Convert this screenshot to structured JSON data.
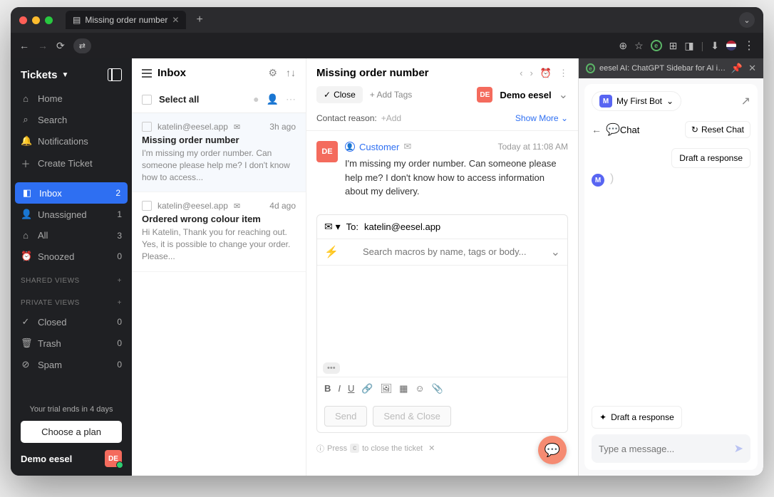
{
  "tab": {
    "title": "Missing order number"
  },
  "ext_bar": {
    "title": "eesel AI: ChatGPT Sidebar for AI in Go..."
  },
  "sidebar": {
    "title": "Tickets",
    "nav": [
      {
        "icon": "⌂",
        "label": "Home"
      },
      {
        "icon": "⌕",
        "label": "Search"
      },
      {
        "icon": "🔔",
        "label": "Notifications"
      },
      {
        "icon": "＋",
        "label": "Create Ticket"
      }
    ],
    "boxes": [
      {
        "icon": "◧",
        "label": "Inbox",
        "count": "2",
        "active": true
      },
      {
        "icon": "👤",
        "label": "Unassigned",
        "count": "1"
      },
      {
        "icon": "⌂",
        "label": "All",
        "count": "3"
      },
      {
        "icon": "⏰",
        "label": "Snoozed",
        "count": "0"
      }
    ],
    "shared": "SHARED VIEWS",
    "private": "PRIVATE VIEWS",
    "views": [
      {
        "icon": "✓",
        "label": "Closed",
        "count": "0"
      },
      {
        "icon": "🗑",
        "label": "Trash",
        "count": "0"
      },
      {
        "icon": "⊘",
        "label": "Spam",
        "count": "0"
      }
    ],
    "trial": "Your trial ends in 4 days",
    "plan": "Choose a plan",
    "account": "Demo eesel",
    "avatar": "DE"
  },
  "inbox": {
    "title": "Inbox",
    "select_all": "Select all",
    "tickets": [
      {
        "from": "katelin@eesel.app",
        "time": "3h ago",
        "subject": "Missing order number",
        "preview": "I'm missing my order number. Can someone please help me? I don't know how to access...",
        "selected": true
      },
      {
        "from": "katelin@eesel.app",
        "time": "4d ago",
        "subject": "Ordered wrong colour item",
        "preview": "Hi Katelin, Thank you for reaching out. Yes, it is possible to change your order. Please..."
      }
    ]
  },
  "thread": {
    "title": "Missing order number",
    "close": "Close",
    "add_tags": "Add Tags",
    "assignee": "Demo eesel",
    "assignee_avatar": "DE",
    "reason_label": "Contact reason:",
    "reason_add": "+Add",
    "show_more": "Show More",
    "message": {
      "avatar": "DE",
      "customer": "Customer",
      "time": "Today at 11:08 AM",
      "body": "I'm missing my order number. Can someone please help me? I don't know how to access information about my delivery."
    },
    "compose": {
      "to_label": "To:",
      "to": "katelin@eesel.app",
      "macro_placeholder": "Search macros by name, tags or body...",
      "send": "Send",
      "send_close": "Send & Close"
    },
    "hint_pre": "Press",
    "hint_key": "c",
    "hint_post": "to close the ticket"
  },
  "panel": {
    "bot": "My First Bot",
    "chat": "Chat",
    "reset": "Reset Chat",
    "draft_chip": "Draft a response",
    "draft_btn": "Draft a response",
    "input_placeholder": "Type a message..."
  }
}
